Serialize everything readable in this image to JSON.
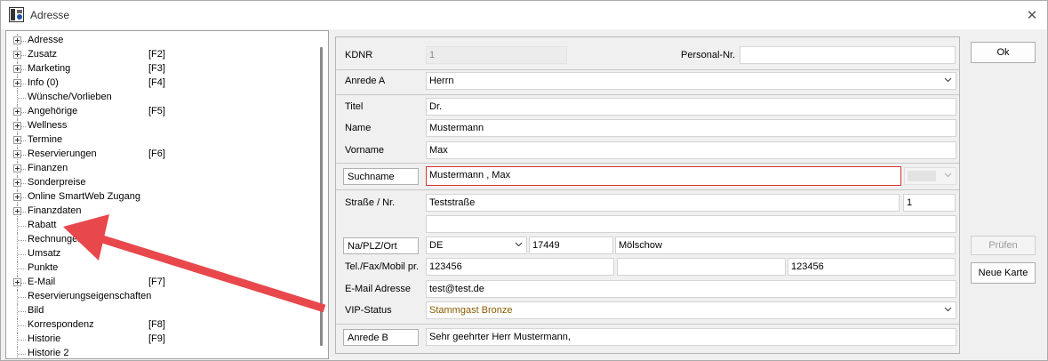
{
  "window": {
    "title": "Adresse",
    "close_glyph": "✕"
  },
  "tree": {
    "items": [
      {
        "label": "Adresse",
        "key": "",
        "expandable": true
      },
      {
        "label": "Zusatz",
        "key": "[F2]",
        "expandable": true
      },
      {
        "label": "Marketing",
        "key": "[F3]",
        "expandable": true
      },
      {
        "label": "Info (0)",
        "key": "[F4]",
        "expandable": true
      },
      {
        "label": "Wünsche/Vorlieben",
        "key": "",
        "expandable": false
      },
      {
        "label": "Angehörige",
        "key": "[F5]",
        "expandable": true
      },
      {
        "label": "Wellness",
        "key": "",
        "expandable": true
      },
      {
        "label": "Termine",
        "key": "",
        "expandable": true
      },
      {
        "label": "Reservierungen",
        "key": "[F6]",
        "expandable": true
      },
      {
        "label": "Finanzen",
        "key": "",
        "expandable": true
      },
      {
        "label": "Sonderpreise",
        "key": "",
        "expandable": true
      },
      {
        "label": "Online SmartWeb Zugang",
        "key": "",
        "expandable": true
      },
      {
        "label": "Finanzdaten",
        "key": "",
        "expandable": true
      },
      {
        "label": "Rabatt",
        "key": "",
        "expandable": false
      },
      {
        "label": "Rechnungen",
        "key": "",
        "expandable": false
      },
      {
        "label": "Umsatz",
        "key": "",
        "expandable": false
      },
      {
        "label": "Punkte",
        "key": "",
        "expandable": false
      },
      {
        "label": "E-Mail",
        "key": "[F7]",
        "expandable": true
      },
      {
        "label": "Reservierungseigenschaften",
        "key": "",
        "expandable": false
      },
      {
        "label": "Bild",
        "key": "",
        "expandable": false
      },
      {
        "label": "Korrespondenz",
        "key": "[F8]",
        "expandable": false
      },
      {
        "label": "Historie",
        "key": "[F9]",
        "expandable": false
      },
      {
        "label": "Historie 2",
        "key": "",
        "expandable": false
      }
    ]
  },
  "form": {
    "kdnr_label": "KDNR",
    "kdnr_value": "1",
    "personal_label": "Personal-Nr.",
    "personal_value": "",
    "anrede_a_label": "Anrede A",
    "anrede_a_value": "Herrn",
    "titel_label": "Titel",
    "titel_value": "Dr.",
    "name_label": "Name",
    "name_value": "Mustermann",
    "vorname_label": "Vorname",
    "vorname_value": "Max",
    "suchname_label": "Suchname",
    "suchname_value": "Mustermann , Max",
    "strasse_label": "Straße / Nr.",
    "strasse_value": "Teststraße",
    "hausnr_value": "1",
    "strasse2_value": "",
    "plz_btn_label": "Na/PLZ/Ort",
    "country_value": "DE",
    "plz_value": "17449",
    "ort_value": "Mölschow",
    "tel_label": "Tel./Fax/Mobil pr.",
    "tel_value": "123456",
    "fax_value": "",
    "mobil_value": "123456",
    "email_label": "E-Mail Adresse",
    "email_value": "test@test.de",
    "vip_label": "VIP-Status",
    "vip_value": "Stammgast Bronze",
    "anrede_b_label": "Anrede B",
    "anrede_b_value": "Sehr geehrter Herr Mustermann,"
  },
  "buttons": {
    "ok": "Ok",
    "pruefen": "Prüfen",
    "neue_karte": "Neue Karte"
  },
  "colors": {
    "vip_text": "#8a5a00",
    "arrow": "#e8474c",
    "suchname_border": "#d33333"
  }
}
